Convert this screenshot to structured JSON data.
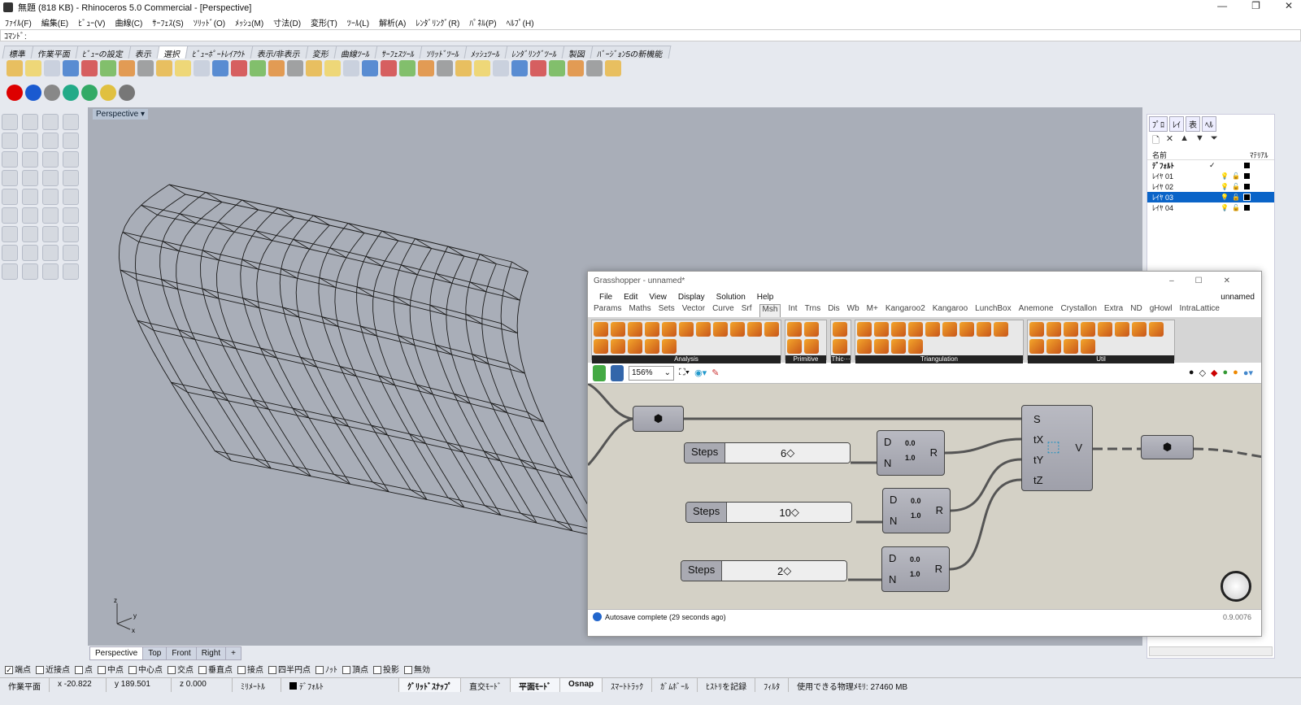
{
  "window": {
    "title": "無題 (818 KB) - Rhinoceros 5.0 Commercial - [Perspective]",
    "min": "—",
    "max": "❐",
    "close": "✕"
  },
  "menu": [
    "ﾌｧｲﾙ(F)",
    "編集(E)",
    "ﾋﾞｭｰ(V)",
    "曲線(C)",
    "ｻｰﾌｪｽ(S)",
    "ｿﾘｯﾄﾞ(O)",
    "ﾒｯｼｭ(M)",
    "寸法(D)",
    "変形(T)",
    "ﾂｰﾙ(L)",
    "解析(A)",
    "ﾚﾝﾀﾞﾘﾝｸﾞ(R)",
    "ﾊﾟﾈﾙ(P)",
    "ﾍﾙﾌﾟ(H)"
  ],
  "command": {
    "label": "ｺﾏﾝﾄﾞ:",
    "value": ""
  },
  "toolbar_tabs": [
    "標準",
    "作業平面",
    "ﾋﾞｭｰの設定",
    "表示",
    "選択",
    "ﾋﾞｭｰﾎﾟｰﾄﾚｲｱｳﾄ",
    "表示/非表示",
    "変形",
    "曲線ﾂｰﾙ",
    "ｻｰﾌｪｽﾂｰﾙ",
    "ｿﾘｯﾄﾞﾂｰﾙ",
    "ﾒｯｼｭﾂｰﾙ",
    "ﾚﾝﾀﾞﾘﾝｸﾞﾂｰﾙ",
    "製図",
    "ﾊﾞｰｼﾞｮﾝ5の新機能"
  ],
  "active_toolbar_tab": "選択",
  "viewport": {
    "label": "Perspective",
    "tabs": [
      "Perspective",
      "Top",
      "Front",
      "Right"
    ],
    "add": "+",
    "axes": {
      "z": "z",
      "y": "y",
      "x": "x"
    }
  },
  "osnap": [
    {
      "label": "端点",
      "checked": true
    },
    {
      "label": "近接点",
      "checked": false
    },
    {
      "label": "点",
      "checked": false
    },
    {
      "label": "中点",
      "checked": false
    },
    {
      "label": "中心点",
      "checked": false
    },
    {
      "label": "交点",
      "checked": false
    },
    {
      "label": "垂直点",
      "checked": false
    },
    {
      "label": "接点",
      "checked": false
    },
    {
      "label": "四半円点",
      "checked": false
    },
    {
      "label": "ﾉｯﾄ",
      "checked": false
    },
    {
      "label": "頂点",
      "checked": false
    },
    {
      "label": "投影",
      "checked": false
    },
    {
      "label": "無効",
      "checked": false
    }
  ],
  "status": {
    "cplane": "作業平面",
    "x": "x -20.822",
    "y": "y 189.501",
    "z": "z 0.000",
    "units": "ﾐﾘﾒｰﾄﾙ",
    "layer": "ﾃﾞﾌｫﾙﾄ",
    "grid_snap": "ｸﾞﾘｯﾄﾞｽﾅｯﾌﾟ",
    "ortho": "直交ﾓｰﾄﾞ",
    "planar": "平面ﾓｰﾄﾞ",
    "osnap": "Osnap",
    "smarttrack": "ｽﾏｰﾄﾄﾗｯｸ",
    "gumball": "ｶﾞﾑﾎﾞｰﾙ",
    "history": "ﾋｽﾄﾘを記録",
    "filter": "ﾌｨﾙﾀ",
    "memory": "使用できる物理ﾒﾓﾘ: 27460 MB"
  },
  "panel": {
    "tabs": [
      "ﾌﾟﾛ",
      "ﾚｲ",
      "表",
      "ﾍﾙ"
    ],
    "col_name": "名前",
    "col_material": "ﾏﾃﾘｱﾙ",
    "layers": [
      {
        "name": "ﾃﾞﾌｫﾙﾄ",
        "current": "✓",
        "selected": false
      },
      {
        "name": "ﾚｲﾔ 01",
        "current": "",
        "selected": false
      },
      {
        "name": "ﾚｲﾔ 02",
        "current": "",
        "selected": false
      },
      {
        "name": "ﾚｲﾔ 03",
        "current": "",
        "selected": true
      },
      {
        "name": "ﾚｲﾔ 04",
        "current": "",
        "selected": false
      }
    ]
  },
  "gh": {
    "title": "Grasshopper - unnamed*",
    "doc": "unnamed",
    "menu": [
      "File",
      "Edit",
      "View",
      "Display",
      "Solution",
      "Help"
    ],
    "tabs": [
      "Params",
      "Maths",
      "Sets",
      "Vector",
      "Curve",
      "Srf",
      "Msh",
      "Int",
      "Trns",
      "Dis",
      "Wb",
      "M+",
      "Kangaroo2",
      "Kangaroo",
      "LunchBox",
      "Anemone",
      "Crystallon",
      "Extra",
      "ND",
      "gHowl",
      "IntraLattice"
    ],
    "active_tab": "Msh",
    "groups": [
      {
        "label": "Analysis",
        "n": 16
      },
      {
        "label": "Primitive",
        "n": 4
      },
      {
        "label": "Thic···",
        "n": 2
      },
      {
        "label": "Triangulation",
        "n": 13
      },
      {
        "label": "Util",
        "n": 12
      }
    ],
    "zoom": "156%",
    "sliders": [
      {
        "label": "Steps",
        "value": "6"
      },
      {
        "label": "Steps",
        "value": "10"
      },
      {
        "label": "Steps",
        "value": "2"
      }
    ],
    "range": {
      "d": "D",
      "n": "N",
      "r": "R",
      "top": "0.0",
      "bot": "1.0"
    },
    "box": {
      "inputs": [
        "S",
        "tX",
        "tY",
        "tZ"
      ],
      "output": "V"
    },
    "status": "Autosave complete (29 seconds ago)",
    "version": "0.9.0076"
  }
}
